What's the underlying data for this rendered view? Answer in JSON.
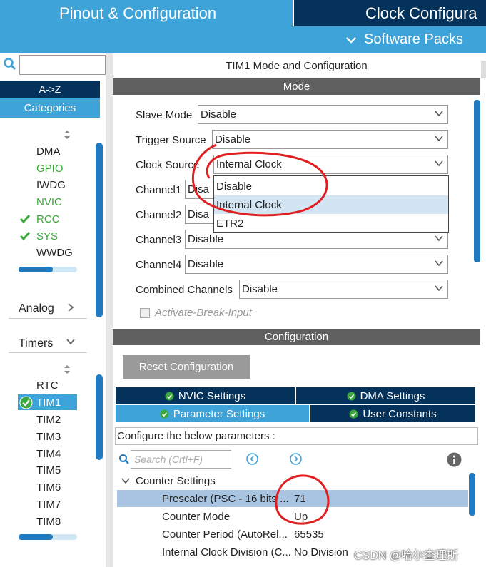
{
  "header": {
    "tab_pinout": "Pinout & Configuration",
    "tab_clock": "Clock Configura",
    "software_packs": "Software Packs"
  },
  "sidebar": {
    "sort_label": "A->Z",
    "categories_label": "Categories",
    "system_items": [
      {
        "label": "DMA",
        "checked": false,
        "green": false
      },
      {
        "label": "GPIO",
        "checked": false,
        "green": true
      },
      {
        "label": "IWDG",
        "checked": false,
        "green": false
      },
      {
        "label": "NVIC",
        "checked": false,
        "green": true
      },
      {
        "label": "RCC",
        "checked": true,
        "green": true
      },
      {
        "label": "SYS",
        "checked": true,
        "green": true
      },
      {
        "label": "WWDG",
        "checked": false,
        "green": false
      }
    ],
    "analog_label": "Analog",
    "timers_label": "Timers",
    "timer_items": [
      "RTC",
      "TIM1",
      "TIM2",
      "TIM3",
      "TIM4",
      "TIM5",
      "TIM6",
      "TIM7",
      "TIM8"
    ],
    "selected_timer": "TIM1"
  },
  "panel": {
    "title": "TIM1 Mode and Configuration",
    "mode_header": "Mode",
    "config_header": "Configuration"
  },
  "mode": {
    "slave_mode": {
      "label": "Slave Mode",
      "value": "Disable"
    },
    "trigger_source": {
      "label": "Trigger Source",
      "value": "Disable"
    },
    "clock_source": {
      "label": "Clock Source",
      "value": "Internal Clock"
    },
    "channel1": {
      "label": "Channel1",
      "value": "Disa"
    },
    "channel2": {
      "label": "Channel2",
      "value": "Disa"
    },
    "channel3": {
      "label": "Channel3",
      "value": "Disable"
    },
    "channel4": {
      "label": "Channel4",
      "value": "Disable"
    },
    "combined": {
      "label": "Combined Channels",
      "value": "Disable"
    },
    "activate_break": "Activate-Break-Input",
    "dropdown_options": [
      "Disable",
      "Internal Clock",
      "ETR2"
    ],
    "dropdown_highlight": "Internal Clock"
  },
  "config": {
    "reset_label": "Reset Configuration",
    "tabs": {
      "nvic": "NVIC Settings",
      "dma": "DMA Settings",
      "parameter": "Parameter Settings",
      "user_constants": "User Constants"
    },
    "hint": "Configure the below parameters :",
    "search_placeholder": "Search (Crtl+F)",
    "group_label": "Counter Settings",
    "params": [
      {
        "name": "Prescaler (PSC - 16 bits ...",
        "value": "71"
      },
      {
        "name": "Counter Mode",
        "value": "Up"
      },
      {
        "name": "Counter Period (AutoRel...",
        "value": "65535"
      },
      {
        "name": "Internal Clock Division (C...",
        "value": "No Division"
      }
    ]
  },
  "watermark": "CSDN @哈尔查理斯",
  "colors": {
    "accent": "#3ea3d8",
    "dark": "#05325a",
    "header_gray": "#606060",
    "green": "#3aa83a",
    "annotation_red": "#e02020"
  }
}
